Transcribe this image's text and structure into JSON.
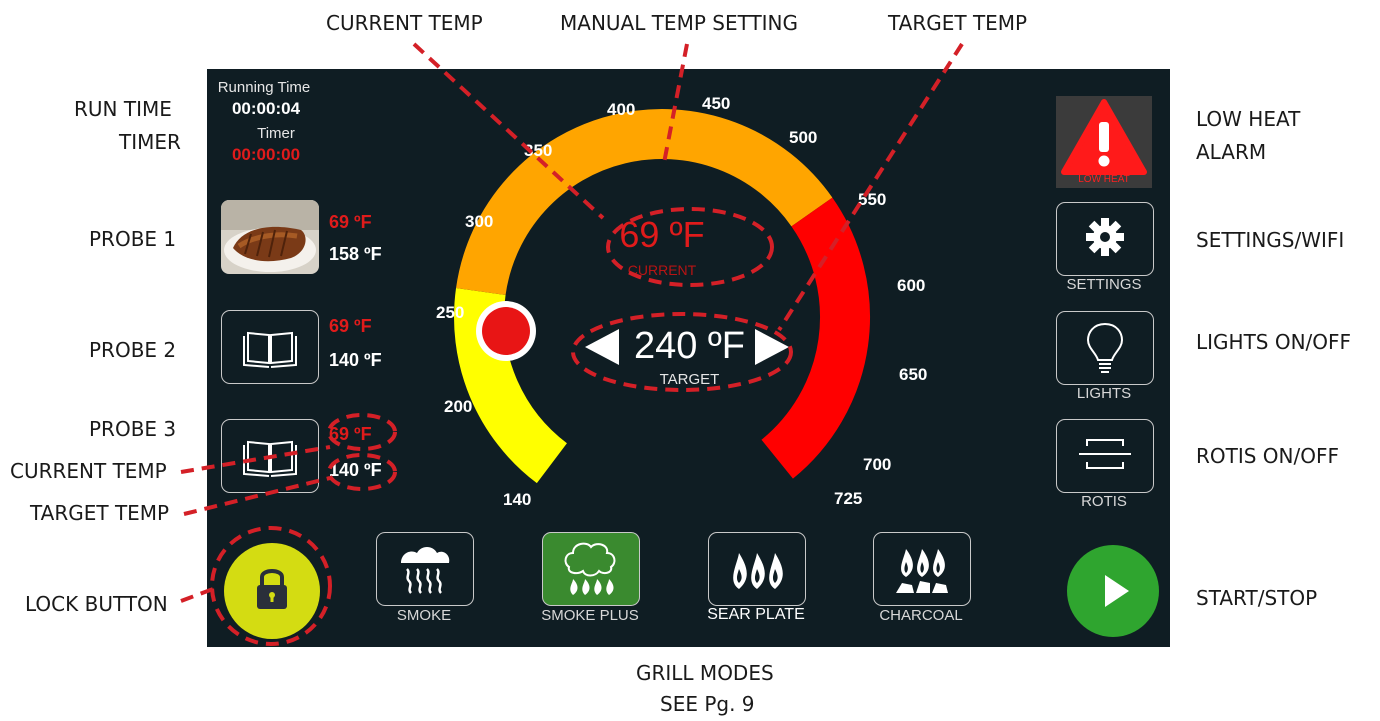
{
  "callouts": {
    "current_temp_top": "CURRENT TEMP",
    "manual_temp_setting": "MANUAL TEMP SETTING",
    "target_temp_top": "TARGET TEMP",
    "run_time": "RUN TIME",
    "timer": "TIMER",
    "probe1": "PROBE 1",
    "probe2": "PROBE 2",
    "probe3": "PROBE 3",
    "current_temp_left": "CURRENT TEMP",
    "target_temp_left": "TARGET TEMP",
    "lock_button": "LOCK BUTTON",
    "low_heat_alarm_1": "LOW HEAT",
    "low_heat_alarm_2": "ALARM",
    "settings_wifi": "SETTINGS/WIFI",
    "lights_on_off": "LIGHTS ON/OFF",
    "rotis_on_off": "ROTIS ON/OFF",
    "start_stop": "START/STOP",
    "grill_modes": "GRILL MODES",
    "see_page": "SEE Pg. 9"
  },
  "screen": {
    "running_time_label": "Running Time",
    "running_time_value": "00:00:04",
    "timer_label": "Timer",
    "timer_value": "00:00:00",
    "probes": [
      {
        "current": "69 ºF",
        "target": "158 ºF",
        "icon": "ribs-photo"
      },
      {
        "current": "69 ºF",
        "target": "140 ºF",
        "icon": "book-icon"
      },
      {
        "current": "69 ºF",
        "target": "140 ºF",
        "icon": "book-icon"
      }
    ],
    "gauge": {
      "scale_labels": [
        "140",
        "200",
        "250",
        "300",
        "350",
        "400",
        "450",
        "500",
        "550",
        "600",
        "650",
        "700",
        "725"
      ],
      "current_value": "69 ºF",
      "current_label": "CURRENT",
      "target_value": "240 ºF",
      "target_label": "TARGET",
      "colors": {
        "low": "#ffff00",
        "mid": "#ffa500",
        "high": "#ff0000"
      }
    },
    "alarm_label": "LOW HEAT",
    "settings_label": "SETTINGS",
    "lights_label": "LIGHTS",
    "rotis_label": "ROTIS",
    "modes": [
      {
        "label": "SMOKE",
        "icon": "smoke-icon"
      },
      {
        "label": "SMOKE PLUS",
        "icon": "smoke-plus-icon"
      },
      {
        "label": "SEAR PLATE",
        "icon": "sear-plate-icon"
      },
      {
        "label": "CHARCOAL",
        "icon": "charcoal-icon"
      }
    ],
    "colors": {
      "accent_red": "#e01b1b",
      "lock_yellow": "#d4dc12",
      "start_green": "#2fa52f",
      "active_mode": "#3a8a2f"
    }
  }
}
